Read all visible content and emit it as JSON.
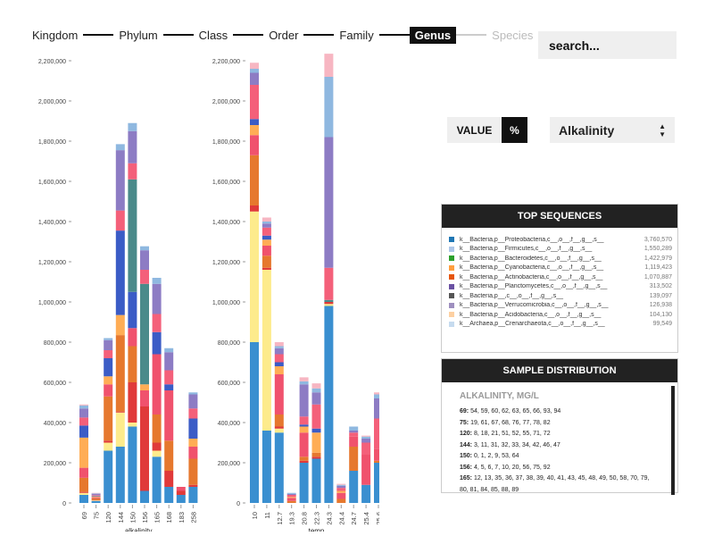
{
  "breadcrumbs": [
    {
      "label": "Kingdom",
      "state": "normal"
    },
    {
      "label": "Phylum",
      "state": "normal"
    },
    {
      "label": "Class",
      "state": "normal"
    },
    {
      "label": "Order",
      "state": "normal"
    },
    {
      "label": "Family",
      "state": "normal"
    },
    {
      "label": "Genus",
      "state": "active"
    },
    {
      "label": "Species",
      "state": "disabled"
    }
  ],
  "search": {
    "placeholder": "search..."
  },
  "toggle": {
    "value_label": "VALUE",
    "percent_label": "%"
  },
  "metric_select": {
    "selected": "Alkalinity"
  },
  "top_sequences": {
    "title": "TOP SEQUENCES",
    "items": [
      {
        "name": "k__Bacteria,p__Proteobacteria,c__,o__,f__,g__,s__",
        "count": "3,760,570",
        "color": "#1f77b4"
      },
      {
        "name": "k__Bacteria,p__Firmicutes,c__,o__,f__,g__,s__",
        "count": "1,550,289",
        "color": "#aec7e8"
      },
      {
        "name": "k__Bacteria,p__Bacteroidetes,c__,o__,f__,g__,s__",
        "count": "1,422,979",
        "color": "#2ca02c"
      },
      {
        "name": "k__Bacteria,p__Cyanobacteria,c__,o__,f__,g__,s__",
        "count": "1,119,423",
        "color": "#ff9f40"
      },
      {
        "name": "k__Bacteria,p__Actinobacteria,c__,o__,f__,g__,s__",
        "count": "1,070,887",
        "color": "#e6550d"
      },
      {
        "name": "k__Bacteria,p__Planctomycetes,c__,o__,f__,g__,s__",
        "count": "313,502",
        "color": "#6a51a3"
      },
      {
        "name": "k__Bacteria,p__,c__,o__,f__,g__,s__",
        "count": "139,097",
        "color": "#555555"
      },
      {
        "name": "k__Bacteria,p__Verrucomicrobia,c__,o__,f__,g__,s__",
        "count": "126,938",
        "color": "#9e8fbf"
      },
      {
        "name": "k__Bacteria,p__Acidobacteria,c__,o__,f__,g__,s__",
        "count": "104,130",
        "color": "#fdd0a2"
      },
      {
        "name": "k__Archaea,p__Crenarchaeota,c__,o__,f__,g__,s__",
        "count": "99,549",
        "color": "#c6dbef"
      }
    ]
  },
  "sample_distribution": {
    "title": "SAMPLE DISTRIBUTION",
    "subtitle": "ALKALINITY, MG/L",
    "rows": [
      {
        "key": "69:",
        "values": "54, 59, 60, 62, 63, 65, 66, 93, 94"
      },
      {
        "key": "75:",
        "values": "19, 61, 67, 68, 76, 77, 78, 82"
      },
      {
        "key": "120:",
        "values": "8, 18, 21, 51, 52, 55, 71, 72"
      },
      {
        "key": "144:",
        "values": "3, 11, 31, 32, 33, 34, 42, 46, 47"
      },
      {
        "key": "150:",
        "values": "0, 1, 2, 9, 53, 64"
      },
      {
        "key": "156:",
        "values": "4, 5, 6, 7, 10, 20, 56, 75, 92"
      },
      {
        "key": "165:",
        "values": "12, 13, 35, 36, 37, 38, 39, 40, 41, 43, 45, 48, 49, 50, 58, 70, 79, 80, 81, 84, 85, 88, 89"
      }
    ]
  },
  "chart_data": [
    {
      "type": "bar",
      "stacked": true,
      "xlabel": "alkalinity",
      "ylabel": "",
      "ylim": [
        0,
        2200000
      ],
      "yticks": [
        "0",
        "200,000",
        "400,000",
        "600,000",
        "800,000",
        "1,000,000",
        "1,200,000",
        "1,400,000",
        "1,600,000",
        "1,800,000",
        "2,000,000",
        "2,200,000"
      ],
      "categories": [
        "69",
        "75",
        "120",
        "144",
        "150",
        "156",
        "165",
        "168",
        "183",
        "258"
      ],
      "series": [
        {
          "color": "#3a8fd0",
          "values": [
            40000,
            10000,
            260000,
            280000,
            380000,
            60000,
            230000,
            80000,
            40000,
            80000
          ]
        },
        {
          "color": "#fdeb8c",
          "values": [
            10000,
            3000,
            40000,
            170000,
            20000,
            0,
            30000,
            0,
            0,
            0
          ]
        },
        {
          "color": "#e03a3a",
          "values": [
            5000,
            2000,
            10000,
            5000,
            200000,
            420000,
            40000,
            80000,
            20000,
            10000
          ]
        },
        {
          "color": "#e6782e",
          "values": [
            70000,
            8000,
            220000,
            380000,
            180000,
            0,
            140000,
            150000,
            0,
            130000
          ]
        },
        {
          "color": "#f0526d",
          "values": [
            50000,
            5000,
            60000,
            0,
            90000,
            80000,
            300000,
            250000,
            20000,
            60000
          ]
        },
        {
          "color": "#ffad55",
          "values": [
            150000,
            5000,
            40000,
            100000,
            0,
            30000,
            0,
            0,
            0,
            40000
          ]
        },
        {
          "color": "#3b5cc6",
          "values": [
            60000,
            3000,
            90000,
            420000,
            180000,
            0,
            110000,
            30000,
            0,
            100000
          ]
        },
        {
          "color": "#4a8a8a",
          "values": [
            0,
            0,
            0,
            0,
            560000,
            500000,
            0,
            0,
            0,
            0
          ]
        },
        {
          "color": "#f4607a",
          "values": [
            40000,
            3000,
            40000,
            100000,
            80000,
            70000,
            90000,
            70000,
            0,
            50000
          ]
        },
        {
          "color": "#8d7cc4",
          "values": [
            45000,
            7000,
            50000,
            300000,
            160000,
            97000,
            150000,
            90000,
            0,
            70000
          ]
        },
        {
          "color": "#8fb8e0",
          "values": [
            15000,
            2000,
            10000,
            30000,
            40000,
            20000,
            30000,
            20000,
            0,
            10000
          ]
        },
        {
          "color": "#f7b6c2",
          "values": [
            5000,
            2000,
            0,
            0,
            0,
            0,
            0,
            0,
            0,
            0
          ]
        }
      ]
    },
    {
      "type": "bar",
      "stacked": true,
      "xlabel": "temp",
      "ylabel": "",
      "ylim": [
        0,
        2200000
      ],
      "yticks": [
        "0",
        "200,000",
        "400,000",
        "600,000",
        "800,000",
        "1,000,000",
        "1,200,000",
        "1,400,000",
        "1,600,000",
        "1,800,000",
        "2,000,000",
        "2,200,000"
      ],
      "categories": [
        "10",
        "11",
        "12.7",
        "19.3",
        "20.8",
        "22.3",
        "24.3",
        "24.4",
        "24.7",
        "25.4",
        "25.6"
      ],
      "series": [
        {
          "color": "#3a8fd0",
          "values": [
            800000,
            360000,
            350000,
            0,
            200000,
            220000,
            980000,
            0,
            160000,
            90000,
            200000
          ]
        },
        {
          "color": "#fdeb8c",
          "values": [
            650000,
            800000,
            20000,
            0,
            0,
            0,
            10000,
            0,
            0,
            0,
            0
          ]
        },
        {
          "color": "#e03a3a",
          "values": [
            30000,
            10000,
            10000,
            0,
            10000,
            10000,
            10000,
            0,
            0,
            0,
            0
          ]
        },
        {
          "color": "#e6782e",
          "values": [
            250000,
            60000,
            60000,
            10000,
            20000,
            20000,
            0,
            20000,
            120000,
            0,
            10000
          ]
        },
        {
          "color": "#f0526d",
          "values": [
            100000,
            50000,
            200000,
            15000,
            120000,
            0,
            0,
            30000,
            50000,
            150000,
            60000
          ]
        },
        {
          "color": "#ffad55",
          "values": [
            50000,
            30000,
            40000,
            5000,
            30000,
            100000,
            0,
            10000,
            0,
            0,
            0
          ]
        },
        {
          "color": "#3b5cc6",
          "values": [
            30000,
            20000,
            20000,
            0,
            10000,
            20000,
            0,
            0,
            0,
            0,
            0
          ]
        },
        {
          "color": "#4a8a8a",
          "values": [
            0,
            0,
            0,
            0,
            0,
            0,
            10000,
            0,
            0,
            0,
            0
          ]
        },
        {
          "color": "#f4607a",
          "values": [
            170000,
            40000,
            40000,
            10000,
            40000,
            120000,
            160000,
            15000,
            20000,
            60000,
            150000
          ]
        },
        {
          "color": "#8d7cc4",
          "values": [
            60000,
            20000,
            30000,
            5000,
            160000,
            60000,
            650000,
            10000,
            10000,
            20000,
            100000
          ]
        },
        {
          "color": "#8fb8e0",
          "values": [
            20000,
            10000,
            10000,
            5000,
            15000,
            20000,
            300000,
            5000,
            20000,
            10000,
            20000
          ]
        },
        {
          "color": "#f7b6c2",
          "values": [
            30000,
            20000,
            20000,
            0,
            20000,
            25000,
            115000,
            5000,
            0,
            5000,
            10000
          ]
        }
      ]
    }
  ]
}
